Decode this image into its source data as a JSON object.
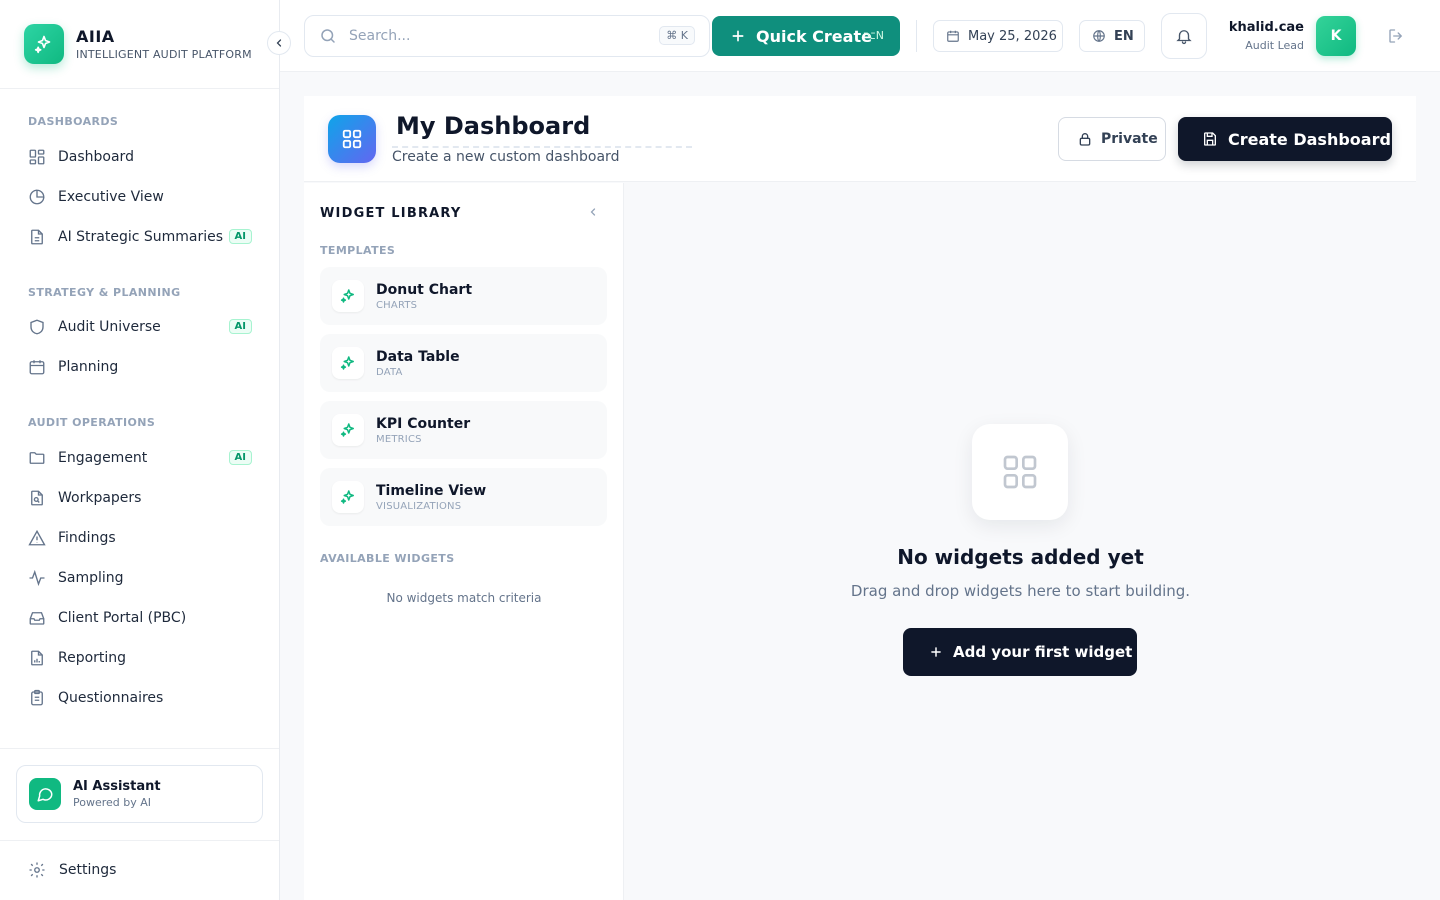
{
  "brand": {
    "name": "AIIA",
    "subtitle": "INTELLIGENT AUDIT PLATFORM"
  },
  "sidebar": {
    "sections": [
      {
        "title": "DASHBOARDS",
        "items": [
          {
            "label": "Dashboard",
            "icon": "grid-icon"
          },
          {
            "label": "Executive View",
            "icon": "pie-icon"
          },
          {
            "label": "AI Strategic Summaries",
            "icon": "document-icon",
            "badge": "AI"
          }
        ]
      },
      {
        "title": "STRATEGY & PLANNING",
        "items": [
          {
            "label": "Audit Universe",
            "icon": "shield-icon",
            "badge": "AI"
          },
          {
            "label": "Planning",
            "icon": "calendar-icon"
          }
        ]
      },
      {
        "title": "AUDIT OPERATIONS",
        "items": [
          {
            "label": "Engagement",
            "icon": "folder-icon",
            "badge": "AI"
          },
          {
            "label": "Workpapers",
            "icon": "file-search-icon"
          },
          {
            "label": "Findings",
            "icon": "warning-icon"
          },
          {
            "label": "Sampling",
            "icon": "activity-icon"
          },
          {
            "label": "Client Portal (PBC)",
            "icon": "inbox-icon"
          },
          {
            "label": "Reporting",
            "icon": "report-icon"
          },
          {
            "label": "Questionnaires",
            "icon": "clipboard-icon"
          }
        ]
      }
    ],
    "assistant": {
      "title": "AI Assistant",
      "subtitle": "Powered by AI"
    },
    "settings_label": "Settings"
  },
  "header": {
    "search_placeholder": "Search...",
    "search_shortcut": "⌘ K",
    "quick_create_label": "Quick Create",
    "quick_create_shortcut": "⌥N",
    "date": "May 25, 2026",
    "language": "EN",
    "user": {
      "name": "khalid.cae",
      "role": "Audit Lead",
      "initial": "K"
    }
  },
  "dashboard": {
    "title": "My Dashboard",
    "subtitle": "Create a new custom dashboard",
    "private_label": "Private",
    "create_label": "Create Dashboard"
  },
  "library": {
    "title": "WIDGET LIBRARY",
    "templates_title": "TEMPLATES",
    "templates": [
      {
        "name": "Donut Chart",
        "category": "CHARTS"
      },
      {
        "name": "Data Table",
        "category": "DATA"
      },
      {
        "name": "KPI Counter",
        "category": "METRICS"
      },
      {
        "name": "Timeline View",
        "category": "VISUALIZATIONS"
      }
    ],
    "available_title": "AVAILABLE WIDGETS",
    "no_match": "No widgets match criteria"
  },
  "canvas": {
    "empty_title": "No widgets added yet",
    "empty_subtitle": "Drag and drop widgets here to start building.",
    "add_label": "Add your first widget"
  },
  "colors": {
    "accent": "#10b981",
    "primary_dark": "#0f172a",
    "quick_create": "#0f8f7d"
  }
}
